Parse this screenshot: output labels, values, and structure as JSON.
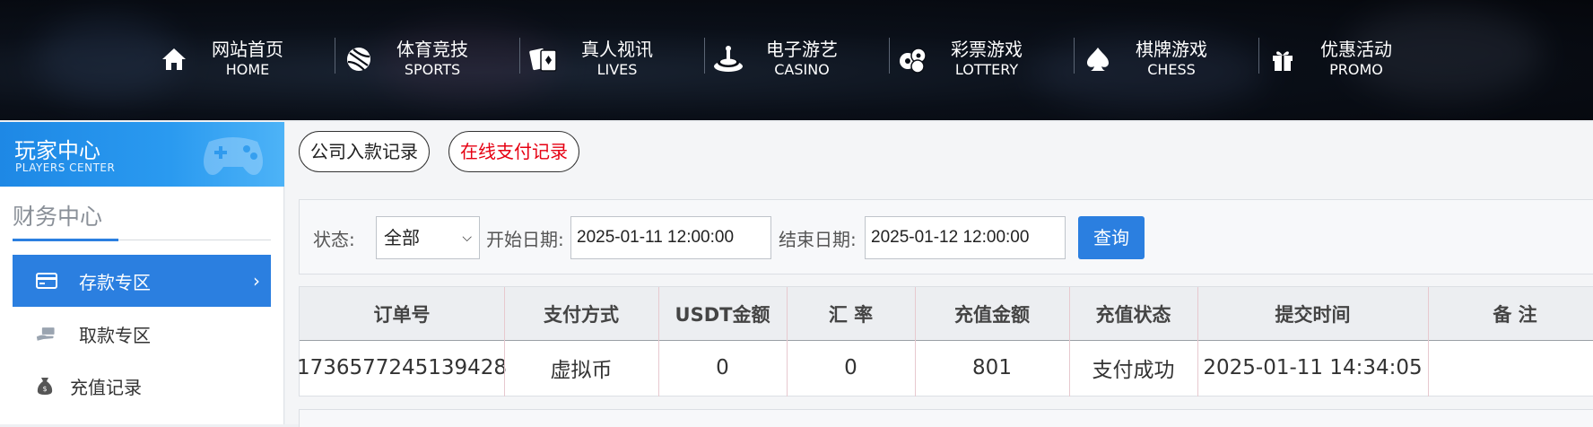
{
  "nav": {
    "items": [
      {
        "zh": "网站首页",
        "en": "HOME",
        "icon": "home-icon"
      },
      {
        "zh": "体育竞技",
        "en": "SPORTS",
        "icon": "ball-icon"
      },
      {
        "zh": "真人视讯",
        "en": "LIVES",
        "icon": "cards-icon"
      },
      {
        "zh": "电子游艺",
        "en": "CASINO",
        "icon": "slot-icon"
      },
      {
        "zh": "彩票游戏",
        "en": "LOTTERY",
        "icon": "lottery-balls-icon"
      },
      {
        "zh": "棋牌游戏",
        "en": "CHESS",
        "icon": "spade-icon"
      },
      {
        "zh": "优惠活动",
        "en": "PROMO",
        "icon": "gift-icon"
      }
    ]
  },
  "sidebar": {
    "banner_zh": "玩家中心",
    "banner_en": "PLAYERS CENTER",
    "section_title": "财务中心",
    "items": [
      {
        "label": "存款专区",
        "icon": "card-icon",
        "active": true
      },
      {
        "label": "取款专区",
        "icon": "hand-money-icon",
        "active": false
      },
      {
        "label": "充值记录",
        "icon": "money-bag-icon",
        "active": false
      }
    ]
  },
  "tabs": {
    "company_deposit": "公司入款记录",
    "online_payment": "在线支付记录"
  },
  "filter": {
    "status_label": "状态:",
    "status_value": "全部",
    "start_label": "开始日期:",
    "start_value": "2025-01-11 12:00:00",
    "end_label": "结束日期:",
    "end_value": "2025-01-12 12:00:00",
    "query_button": "查询"
  },
  "table": {
    "headers": [
      "订单号",
      "支付方式",
      "USDT金额",
      "汇 率",
      "充值金额",
      "充值状态",
      "提交时间",
      "备 注"
    ],
    "rows": [
      [
        "1736577245139428",
        "虚拟币",
        "0",
        "0",
        "801",
        "支付成功",
        "2025-01-11 14:34:05",
        ""
      ]
    ]
  },
  "colors": {
    "accent": "#2b7fe0",
    "tab_active_text": "#e60012"
  }
}
